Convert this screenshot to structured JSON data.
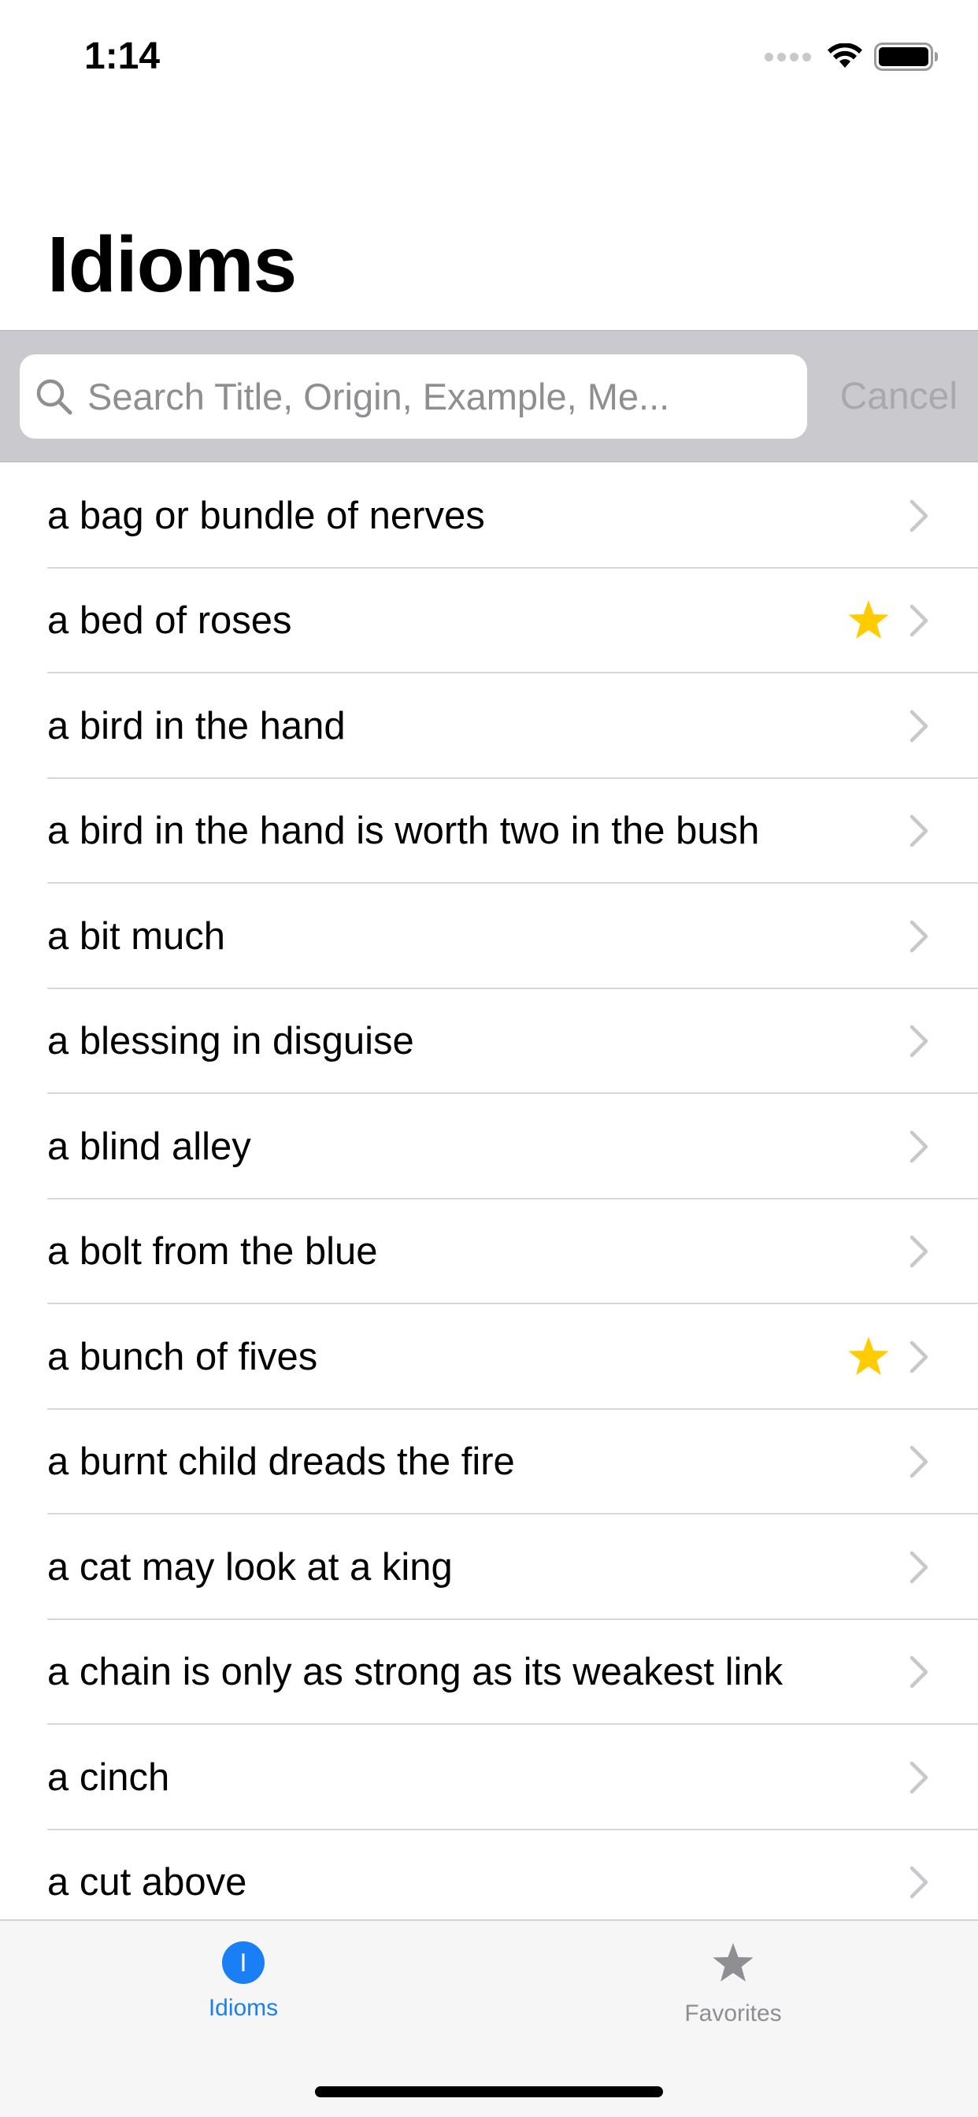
{
  "status_bar": {
    "time": "1:14"
  },
  "header": {
    "title": "Idioms"
  },
  "search": {
    "placeholder": "Search Title, Origin, Example, Me...",
    "cancel_label": "Cancel"
  },
  "list": {
    "items": [
      {
        "label": "a bag or bundle of nerves",
        "favorite": false
      },
      {
        "label": "a bed of roses",
        "favorite": true
      },
      {
        "label": "a bird in the hand",
        "favorite": false
      },
      {
        "label": "a bird in the hand is worth two in the bush",
        "favorite": false
      },
      {
        "label": "a bit much",
        "favorite": false
      },
      {
        "label": "a blessing in disguise",
        "favorite": false
      },
      {
        "label": "a blind alley",
        "favorite": false
      },
      {
        "label": "a bolt from the blue",
        "favorite": false
      },
      {
        "label": "a bunch of fives",
        "favorite": true
      },
      {
        "label": "a burnt child dreads the fire",
        "favorite": false
      },
      {
        "label": "a cat may look at a king",
        "favorite": false
      },
      {
        "label": "a chain is only as strong as its weakest link",
        "favorite": false
      },
      {
        "label": "a cinch",
        "favorite": false
      },
      {
        "label": "a cut above",
        "favorite": false
      }
    ]
  },
  "tab_bar": {
    "tabs": [
      {
        "label": "Idioms",
        "icon": "idioms-circle-icon",
        "icon_text": "I",
        "selected": true
      },
      {
        "label": "Favorites",
        "icon": "star-icon",
        "selected": false
      }
    ]
  },
  "colors": {
    "accent": "#1a7ff5",
    "star": "#ffcc00",
    "chevron": "#c7c7cc",
    "search_bg": "#c9c9ce"
  }
}
